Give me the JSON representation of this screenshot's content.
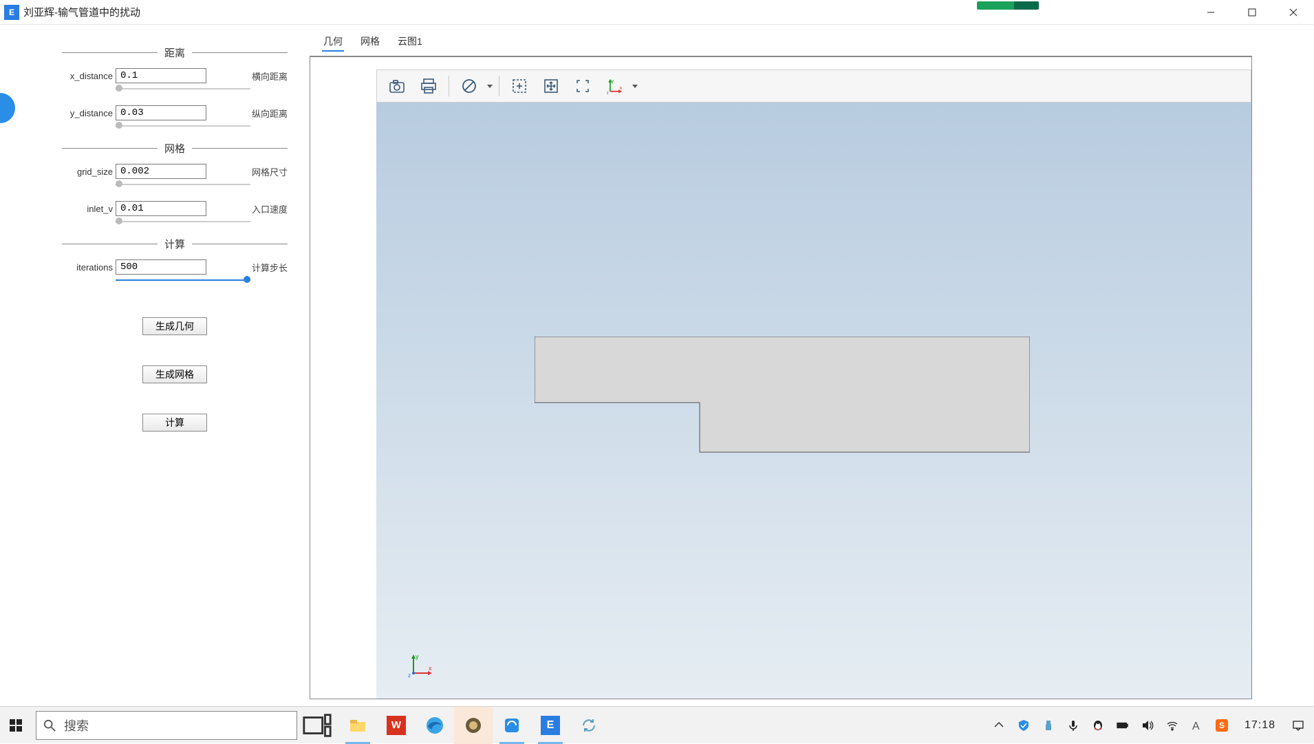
{
  "window": {
    "title": "刘亚辉-输气管道中的扰动",
    "app_icon_letter": "E"
  },
  "sidebar": {
    "sections": {
      "distance": {
        "title": "距离"
      },
      "grid": {
        "title": "网格"
      },
      "calc": {
        "title": "计算"
      }
    },
    "params": {
      "x_distance": {
        "label": "x_distance",
        "value": "0.1",
        "rlabel": "横向距离",
        "fill_pct": 2
      },
      "y_distance": {
        "label": "y_distance",
        "value": "0.03",
        "rlabel": "纵向距离",
        "fill_pct": 2
      },
      "grid_size": {
        "label": "grid_size",
        "value": "0.002",
        "rlabel": "网格尺寸",
        "fill_pct": 2
      },
      "inlet_v": {
        "label": "inlet_v",
        "value": "0.01",
        "rlabel": "入口速度",
        "fill_pct": 2
      },
      "iterations": {
        "label": "iterations",
        "value": "500",
        "rlabel": "计算步长",
        "fill_pct": 100
      }
    },
    "buttons": {
      "gen_geom": "生成几何",
      "gen_mesh": "生成网格",
      "run_calc": "计算"
    }
  },
  "tabs": [
    "几何",
    "网格",
    "云图1"
  ],
  "active_tab_index": 0,
  "toolbar_icons": [
    "camera",
    "print",
    "nosymbol",
    "zoom-select",
    "move",
    "fit",
    "axes"
  ],
  "taskbar": {
    "search_placeholder": "搜索",
    "clock": "17:18"
  }
}
